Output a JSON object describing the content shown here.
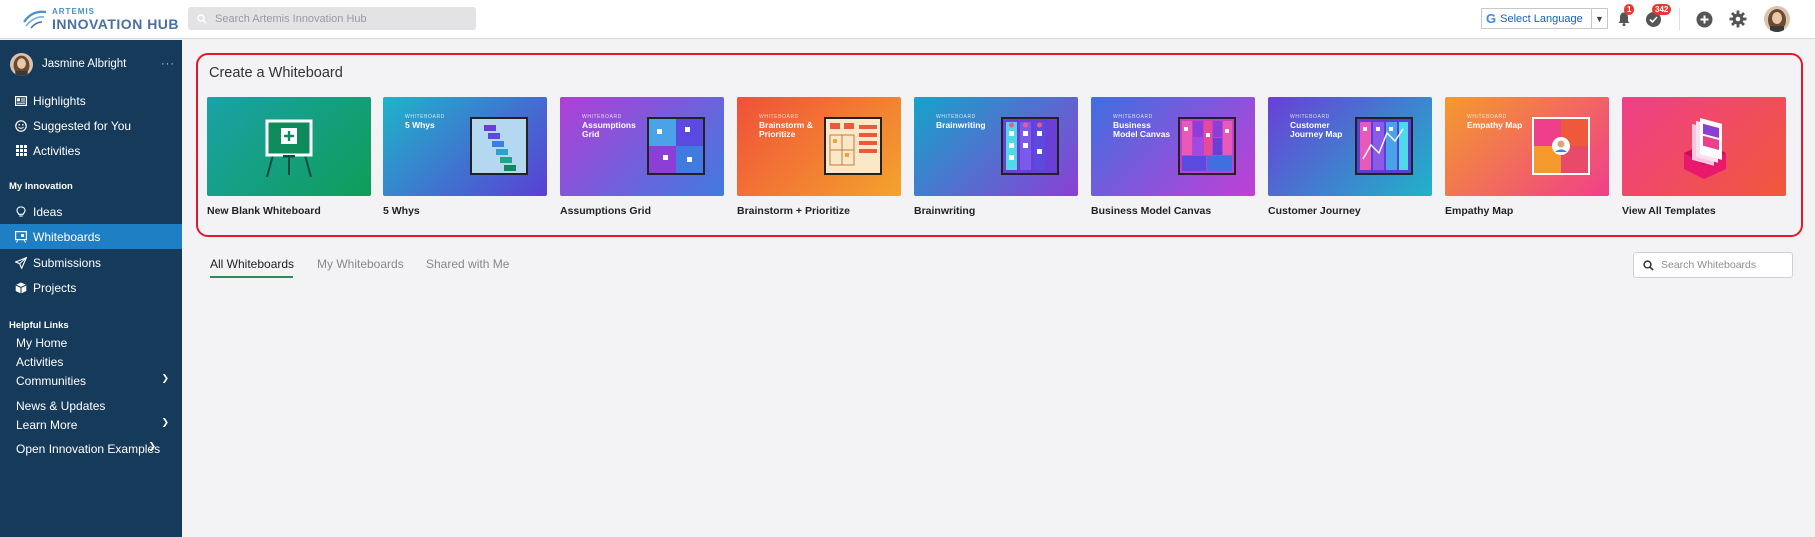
{
  "header": {
    "logo_small": "ARTEMIS",
    "logo_big": "INNOVATION HUB",
    "search_placeholder": "Search Artemis Innovation Hub",
    "language_label": "Select Language",
    "notifications_count": "1",
    "activity_count": "342"
  },
  "sidebar": {
    "user_name": "Jasmine Albright",
    "more_label": "···",
    "top_items": [
      {
        "label": "Highlights",
        "icon": "newspaper-icon"
      },
      {
        "label": "Suggested for You",
        "icon": "smiley-icon"
      },
      {
        "label": "Activities",
        "icon": "grid-icon"
      }
    ],
    "my_innovation_heading": "My Innovation",
    "innovation_items": [
      {
        "label": "Ideas",
        "icon": "lightbulb-icon"
      },
      {
        "label": "Whiteboards",
        "icon": "whiteboard-icon",
        "active": true
      },
      {
        "label": "Submissions",
        "icon": "paper-plane-icon"
      },
      {
        "label": "Projects",
        "icon": "cube-icon"
      }
    ],
    "helpful_links_heading": "Helpful Links",
    "links": [
      {
        "label": "My Home"
      },
      {
        "label": "Activities"
      },
      {
        "label": "Communities",
        "expandable": true
      },
      {
        "label": "News & Updates"
      },
      {
        "label": "Learn More",
        "expandable": true
      },
      {
        "label": "Open Innovation Examples",
        "expandable": true
      }
    ]
  },
  "create": {
    "title": "Create a Whiteboard",
    "cards": [
      {
        "label": "New Blank Whiteboard",
        "thumb_name": "",
        "gradient": [
          "#1aa2a8",
          "#0f9d58"
        ]
      },
      {
        "label": "5 Whys",
        "thumb_name": "5 Whys",
        "gradient": [
          "#1fb4c9",
          "#5a3fd4"
        ]
      },
      {
        "label": "Assumptions Grid",
        "thumb_name": "Assumptions Grid",
        "gradient": [
          "#b03fd6",
          "#3f7be0"
        ]
      },
      {
        "label": "Brainstorm + Prioritize",
        "thumb_name": "Brainstorm & Prioritize",
        "gradient": [
          "#f0503a",
          "#f4a32d"
        ]
      },
      {
        "label": "Brainwriting",
        "thumb_name": "Brainwriting",
        "gradient": [
          "#16a3c8",
          "#8b3fd6"
        ]
      },
      {
        "label": "Business Model Canvas",
        "thumb_name": "Business Model Canvas",
        "gradient": [
          "#3f6fe0",
          "#c23fd6"
        ]
      },
      {
        "label": "Customer Journey",
        "thumb_name": "Customer Journey Map",
        "gradient": [
          "#6a3fd6",
          "#1fb4c9"
        ]
      },
      {
        "label": "Empathy Map",
        "thumb_name": "Empathy Map",
        "gradient": [
          "#f49a2d",
          "#ef3f8a"
        ]
      },
      {
        "label": "View All Templates",
        "thumb_name": "",
        "gradient": [
          "#ef3f8a",
          "#f0583a"
        ]
      }
    ],
    "small_tag": "WHITEBOARD"
  },
  "tabs": [
    "All Whiteboards",
    "My Whiteboards",
    "Shared with Me"
  ],
  "wb_search_placeholder": "Search Whiteboards"
}
